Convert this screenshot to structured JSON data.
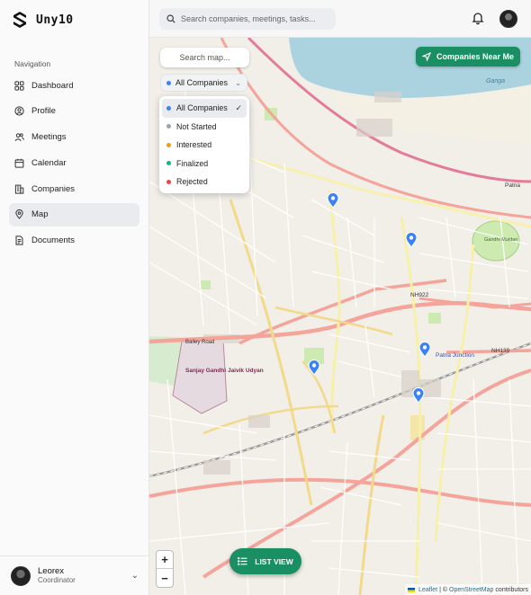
{
  "app": {
    "name": "Uny10"
  },
  "topbar": {
    "search_placeholder": "Search companies, meetings, tasks..."
  },
  "sidebar": {
    "heading": "Navigation",
    "items": [
      {
        "label": "Dashboard",
        "icon": "dashboard-icon"
      },
      {
        "label": "Profile",
        "icon": "profile-icon"
      },
      {
        "label": "Meetings",
        "icon": "users-icon"
      },
      {
        "label": "Calendar",
        "icon": "calendar-icon"
      },
      {
        "label": "Companies",
        "icon": "building-icon"
      },
      {
        "label": "Map",
        "icon": "map-pin-icon",
        "active": true
      },
      {
        "label": "Documents",
        "icon": "document-icon"
      }
    ]
  },
  "user": {
    "name": "Leorex",
    "role": "Coordinator"
  },
  "map": {
    "search_placeholder": "Search map...",
    "filter_selected": "All Companies",
    "filter_options": [
      {
        "label": "All Companies",
        "color": "#3b82f6",
        "selected": true
      },
      {
        "label": "Not Started",
        "color": "#9ca3af"
      },
      {
        "label": "Interested",
        "color": "#f59e0b"
      },
      {
        "label": "Finalized",
        "color": "#10b981"
      },
      {
        "label": "Rejected",
        "color": "#ef4444"
      }
    ],
    "near_me_label": "Companies Near Me",
    "list_view_label": "LIST VIEW",
    "zoom_in": "+",
    "zoom_out": "−",
    "attribution": {
      "leaflet": "Leaflet",
      "sep": "| ©",
      "osm": "OpenStreetMap",
      "suffix": "contributors"
    },
    "place_labels": {
      "park": "Sanjay Gandhi Jaivik Udyan",
      "junction": "Patna Junction",
      "river": "Ganga",
      "nh922": "NH922",
      "nh139": "NH139",
      "bailey_road": "Bailey Road",
      "patna": "Patna",
      "gandhi_maidan": "Gandhi Maidan"
    }
  },
  "colors": {
    "accent": "#1a8f63",
    "pin": "#3b82f6",
    "river": "#aad3df",
    "major_road": "#f4a49a"
  }
}
